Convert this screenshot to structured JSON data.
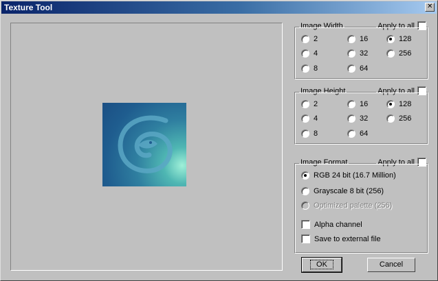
{
  "window": {
    "title": "Texture Tool"
  },
  "groups": {
    "width": {
      "legend": "Image Width",
      "apply_all": "Apply to all",
      "options": [
        "2",
        "4",
        "8",
        "16",
        "32",
        "64",
        "128",
        "256"
      ],
      "selected": "128"
    },
    "height": {
      "legend": "Image Height",
      "apply_all": "Apply to all",
      "options": [
        "2",
        "4",
        "8",
        "16",
        "32",
        "64",
        "128",
        "256"
      ],
      "selected": "128"
    },
    "format": {
      "legend": "Image Format",
      "apply_all": "Apply to all",
      "options": [
        "RGB 24 bit (16.7 Million)",
        "Grayscale 8 bit (256)",
        "Optimized palette (256)"
      ],
      "selected": "RGB 24 bit (16.7 Million)",
      "disabled": "Optimized palette (256)",
      "checkboxes": [
        "Alpha channel",
        "Save to external file"
      ]
    }
  },
  "buttons": {
    "ok": "OK",
    "cancel": "Cancel"
  },
  "colors": {
    "title_start": "#0a246a",
    "title_end": "#a6caf0",
    "face": "#c0c0c0"
  }
}
